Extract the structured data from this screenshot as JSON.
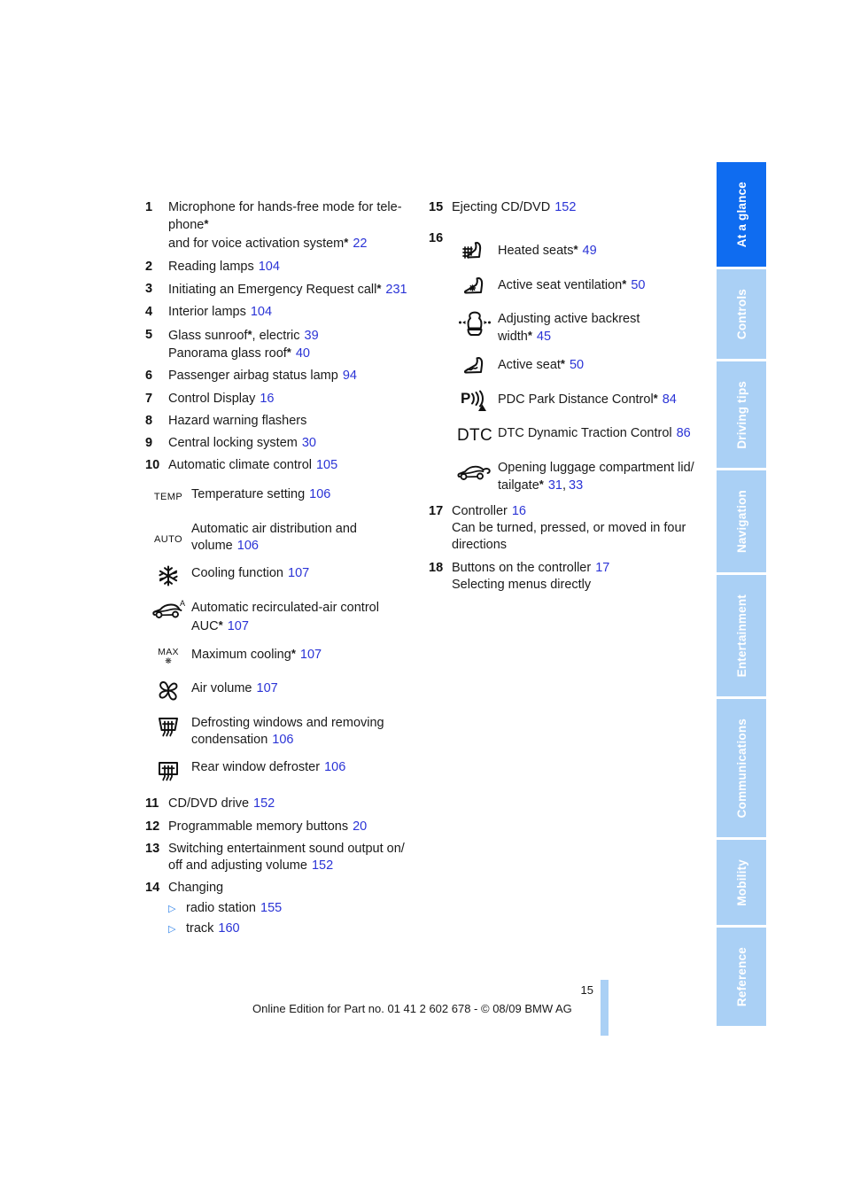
{
  "page": {
    "number": "15",
    "footer_text": "Online Edition for Part no. 01 41 2 602 678 - © 08/09 BMW AG"
  },
  "colors": {
    "page_ref_blue": "#2a33d6",
    "tab_active_blue": "#0f6cf0",
    "tab_inactive_blue": "#aad0f5",
    "bullet_blue": "#2a7fe8",
    "text_black": "#1a1a1a"
  },
  "tabs": [
    {
      "label": "At a glance",
      "active": true
    },
    {
      "label": "Controls",
      "active": false
    },
    {
      "label": "Driving tips",
      "active": false
    },
    {
      "label": "Navigation",
      "active": false
    },
    {
      "label": "Entertainment",
      "active": false
    },
    {
      "label": "Communications",
      "active": false
    },
    {
      "label": "Mobility",
      "active": false
    },
    {
      "label": "Reference",
      "active": false
    }
  ],
  "left_column": {
    "items": [
      {
        "num": "1",
        "line1": "Microphone for hands-free mode for tele-",
        "line2": "phone",
        "line2_star": "*",
        "line3": "and for voice activation system",
        "line3_star": "*",
        "page": "22"
      },
      {
        "num": "2",
        "text": "Reading lamps",
        "page": "104"
      },
      {
        "num": "3",
        "text": "Initiating an Emergency Request call",
        "star": "*",
        "page": "231"
      },
      {
        "num": "4",
        "text": "Interior lamps",
        "page": "104"
      },
      {
        "num": "5",
        "text": "Glass sunroof",
        "star": "*",
        "text_tail": ", electric",
        "page": "39",
        "sub_text": "Panorama glass roof",
        "sub_star": "*",
        "sub_page": "40"
      },
      {
        "num": "6",
        "text": "Passenger airbag status lamp",
        "page": "94"
      },
      {
        "num": "7",
        "text": "Control Display",
        "page": "16"
      },
      {
        "num": "8",
        "text": "Hazard warning flashers",
        "page": ""
      },
      {
        "num": "9",
        "text": "Central locking system",
        "page": "30"
      },
      {
        "num": "10",
        "text": "Automatic climate control",
        "page": "105"
      }
    ],
    "climate_icons": [
      {
        "icon": "temp-text-icon",
        "icon_text": "TEMP",
        "label": "Temperature setting",
        "page": "106"
      },
      {
        "icon": "auto-text-icon",
        "icon_text": "AUTO",
        "label": "Automatic air distribution and",
        "label2": "volume",
        "page": "106"
      },
      {
        "icon": "snowflake-icon",
        "icon_text": "",
        "label": "Cooling function",
        "page": "107"
      },
      {
        "icon": "recirculated-air-car-icon",
        "icon_text": "",
        "label": "Automatic recirculated-air control",
        "label2": "AUC",
        "label2_star": "*",
        "page": "107"
      },
      {
        "icon": "max-cooling-icon",
        "icon_text": "MAX",
        "label": "Maximum cooling",
        "star": "*",
        "page": "107"
      },
      {
        "icon": "fan-icon",
        "icon_text": "",
        "label": "Air volume",
        "page": "107"
      },
      {
        "icon": "windshield-defrost-icon",
        "icon_text": "",
        "label": "Defrosting windows and removing",
        "label2": "condensation",
        "page": "106"
      },
      {
        "icon": "rear-defroster-icon",
        "icon_text": "",
        "label": "Rear window defroster",
        "page": "106"
      }
    ],
    "items_lower": [
      {
        "num": "11",
        "text": "CD/DVD drive",
        "page": "152"
      },
      {
        "num": "12",
        "text": "Programmable memory buttons",
        "page": "20"
      },
      {
        "num": "13",
        "text": "Switching entertainment sound output on/",
        "sub_text": "off and adjusting volume",
        "page": "152"
      },
      {
        "num": "14",
        "text": "Changing",
        "page": ""
      }
    ],
    "changing_bullets": [
      {
        "bullet": "▷",
        "label": "radio station",
        "page": "155"
      },
      {
        "bullet": "▷",
        "label": "track",
        "page": "160"
      }
    ]
  },
  "right_column": {
    "item_15": {
      "num": "15",
      "text": "Ejecting CD/DVD",
      "page": "152"
    },
    "item_16_num": "16",
    "seat_icons": [
      {
        "icon": "heated-seat-icon",
        "label": "Heated seats",
        "star": "*",
        "page": "49"
      },
      {
        "icon": "seat-ventilation-icon",
        "label": "Active seat ventilation",
        "star": "*",
        "page": "50"
      },
      {
        "icon": "backrest-width-icon",
        "label": "Adjusting active backrest",
        "label2": "width",
        "label2_star": "*",
        "page": "45"
      },
      {
        "icon": "active-seat-icon",
        "label": "Active seat",
        "star": "*",
        "page": "50"
      },
      {
        "icon": "pdc-icon",
        "label": "PDC Park Distance Control",
        "star": "*",
        "page": "84"
      },
      {
        "icon": "dtc-text-icon",
        "icon_text": "DTC",
        "label": "DTC Dynamic Traction Control",
        "page": "86"
      },
      {
        "icon": "trunk-open-car-icon",
        "label": "Opening luggage compartment lid/",
        "label2": "tailgate",
        "label2_star": "*",
        "page": "31",
        "page2": "33"
      }
    ],
    "items_lower": [
      {
        "num": "17",
        "text": "Controller",
        "page": "16",
        "sub_text": "Can be turned, pressed, or moved in four",
        "sub_text2": "directions"
      },
      {
        "num": "18",
        "text": "Buttons on the controller",
        "page": "17",
        "sub_text": "Selecting menus directly"
      }
    ]
  }
}
